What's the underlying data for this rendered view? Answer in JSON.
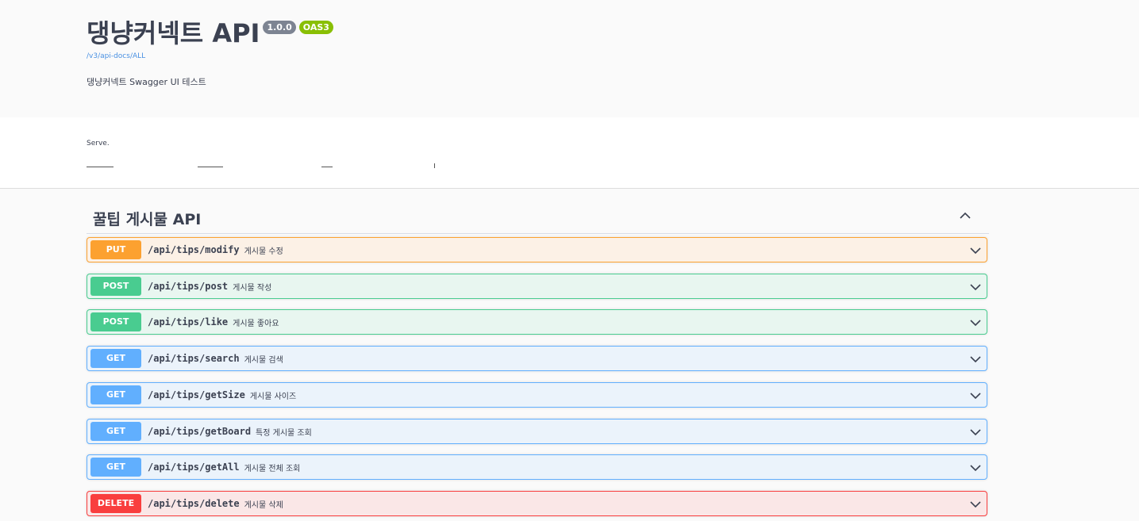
{
  "info": {
    "title": "댕냥커넥트 API",
    "version": "1.0.0",
    "oas": "OAS3",
    "spec_url": "/v3/api-docs/ALL",
    "description": "댕냥커넥트 Swagger UI 테스트"
  },
  "servers": {
    "label": "Serve."
  },
  "tag": {
    "name": "꿀팁 게시물 API"
  },
  "operations": [
    {
      "method": "PUT",
      "path": "/api/tips/modify",
      "summary": "게시물 수정"
    },
    {
      "method": "POST",
      "path": "/api/tips/post",
      "summary": "게시물 작성"
    },
    {
      "method": "POST",
      "path": "/api/tips/like",
      "summary": "게시물 좋아요"
    },
    {
      "method": "GET",
      "path": "/api/tips/search",
      "summary": "게시물 검색"
    },
    {
      "method": "GET",
      "path": "/api/tips/getSize",
      "summary": "게시물 사이즈"
    },
    {
      "method": "GET",
      "path": "/api/tips/getBoard",
      "summary": "특정 게시물 조회"
    },
    {
      "method": "GET",
      "path": "/api/tips/getAll",
      "summary": "게시물 전체 조회"
    },
    {
      "method": "DELETE",
      "path": "/api/tips/delete",
      "summary": "게시물 삭제"
    }
  ],
  "colors": {
    "put": "#fca130",
    "post": "#49cc90",
    "get": "#61affe",
    "delete": "#f93e3e",
    "link": "#4990e2"
  },
  "icons": {
    "tag_toggle": "chevron-up-icon",
    "operation_toggle": "chevron-down-icon"
  }
}
